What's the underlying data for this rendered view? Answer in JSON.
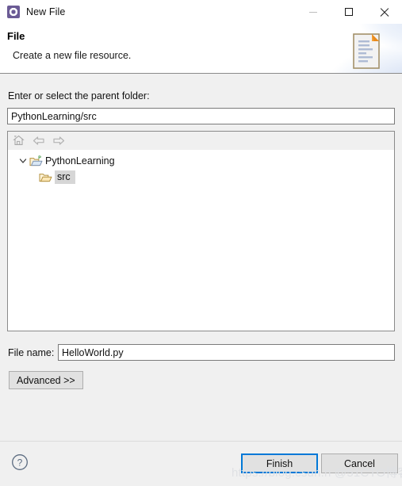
{
  "window": {
    "title": "New File",
    "icon": "eclipse-gear-icon",
    "controls": {
      "minimize": "minimize-icon",
      "maximize": "maximize-icon",
      "close": "close-icon"
    }
  },
  "header": {
    "title": "File",
    "description": "Create a new file resource.",
    "icon": "new-file-document-icon"
  },
  "parent_folder": {
    "label": "Enter or select the parent folder:",
    "value": "PythonLearning/src",
    "placeholder": ""
  },
  "tree": {
    "toolbar": [
      {
        "name": "home-icon",
        "enabled": false
      },
      {
        "name": "back-arrow-icon",
        "enabled": false
      },
      {
        "name": "forward-arrow-icon",
        "enabled": false
      }
    ],
    "nodes": [
      {
        "label": "PythonLearning",
        "icon": "project-folder-icon",
        "badge": "P",
        "expanded": true,
        "selected": false
      },
      {
        "label": "src",
        "icon": "source-folder-icon",
        "badge": "",
        "expanded": false,
        "selected": true
      }
    ]
  },
  "file_name": {
    "label": "File name:",
    "value": "HelloWorld.py",
    "placeholder": ""
  },
  "buttons": {
    "advanced": "Advanced >>",
    "finish": "Finish",
    "cancel": "Cancel",
    "help": "help-icon"
  },
  "watermark": "https://blog.csdn.n  @51CTO博客",
  "colors": {
    "accent": "#0078d7",
    "dialog_bg": "#f0f0f0",
    "header_bg": "#ffffff",
    "title_icon": "#6b5b95",
    "selection": "#d6d6d6"
  }
}
